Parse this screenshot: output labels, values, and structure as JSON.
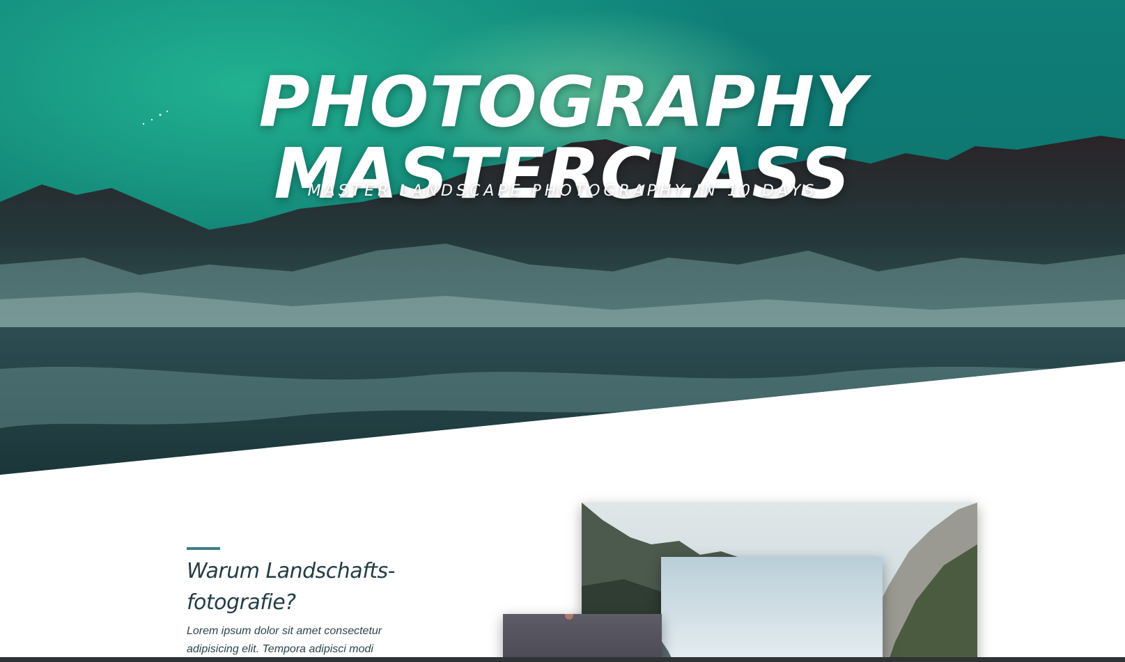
{
  "hero": {
    "title_line_1": "PHOTOGRAPHY",
    "title_line_2": "MASTERCLASS",
    "subtitle": "MASTER LANDSCAPE PHOTOGRAPHY IN 10 DAYS",
    "image": "aurora-mountain-lake-landscape"
  },
  "intro": {
    "heading_line_1": "Warum Landschafts-",
    "heading_line_2": "fotografie?",
    "body": "Lorem ipsum dolor sit amet consectetur adipisicing elit. Tempora adipisci modi"
  },
  "gallery": [
    {
      "image": "alpine-valley-photo"
    },
    {
      "image": "misty-sky-photo"
    },
    {
      "image": "dusk-mountain-photo"
    }
  ],
  "colors": {
    "accent": "#3e7e86",
    "heading": "#243d44",
    "hero_sky": "#127a73"
  }
}
